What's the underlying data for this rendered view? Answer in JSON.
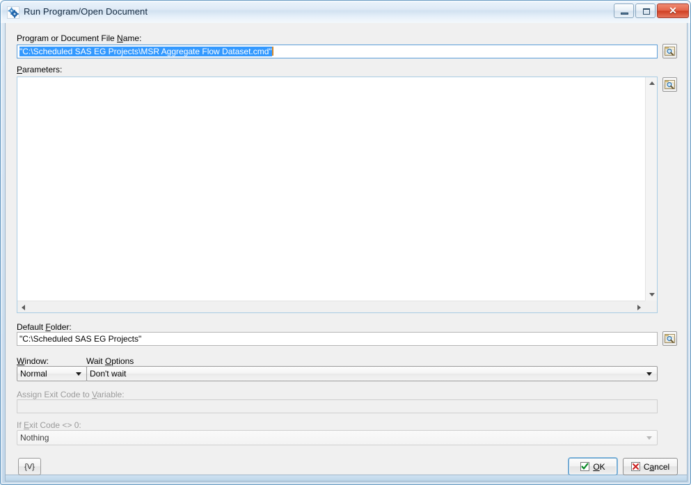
{
  "window": {
    "title": "Run Program/Open Document",
    "icon": "gears-icon",
    "controls": {
      "minimize": "Minimize",
      "maximize": "Maximize",
      "close": "Close",
      "close_glyph": "✕"
    }
  },
  "fields": {
    "program_file": {
      "label_pre": "Program or Document File ",
      "label_acc": "N",
      "label_post": "ame:",
      "value": "\"C:\\Scheduled SAS EG Projects\\MSR Aggregate Flow Dataset.cmd\"",
      "selected": true,
      "browse": "Browse",
      "browse_icon": "folder-search-icon"
    },
    "parameters": {
      "label_pre": "",
      "label_acc": "P",
      "label_post": "arameters:",
      "value": "",
      "browse": "Browse",
      "browse_icon": "folder-search-icon"
    },
    "default_folder": {
      "label_pre": "Default ",
      "label_acc": "F",
      "label_post": "older:",
      "value": "\"C:\\Scheduled SAS EG Projects\"",
      "browse": "Browse",
      "browse_icon": "folder-search-icon"
    },
    "window_mode": {
      "label_pre": "",
      "label_acc": "W",
      "label_post": "indow:",
      "value": "Normal",
      "disabled": false
    },
    "wait_options": {
      "label_pre": "Wait ",
      "label_acc": "O",
      "label_post": "ptions",
      "value": "Don't wait",
      "disabled": false
    },
    "exit_code_variable": {
      "label_pre": "Assign Exit Code to ",
      "label_acc": "V",
      "label_post": "ariable:",
      "value": "",
      "disabled": true
    },
    "if_exit_code": {
      "label_pre": "If ",
      "label_acc": "E",
      "label_post": "xit Code <> 0:",
      "value": "Nothing",
      "disabled": true
    }
  },
  "buttons": {
    "variables": {
      "label": "{V}",
      "name": "variables-button"
    },
    "ok": {
      "label_pre": "",
      "label_acc": "O",
      "label_post": "K",
      "icon": "check-icon",
      "is_default": true
    },
    "cancel": {
      "label_pre": "C",
      "label_acc": "a",
      "label_post": "ncel",
      "icon": "x-icon",
      "is_default": false
    }
  },
  "colors": {
    "title_text": "#12283f",
    "selection_bg": "#3399ff",
    "selection_fg": "#ffffff",
    "caret": "#d88a2a",
    "close_button": "#cf3f23",
    "ok_check": "#0a8a27",
    "cancel_x": "#cc2222",
    "client_bg": "#f0f0f0",
    "focus_border": "#5b9dd9",
    "disabled_text": "#9a9a9a"
  },
  "scrollbars": {
    "vertical": {
      "up": "scroll-up",
      "down": "scroll-down"
    },
    "horizontal": {
      "left": "scroll-left",
      "right": "scroll-right"
    }
  }
}
